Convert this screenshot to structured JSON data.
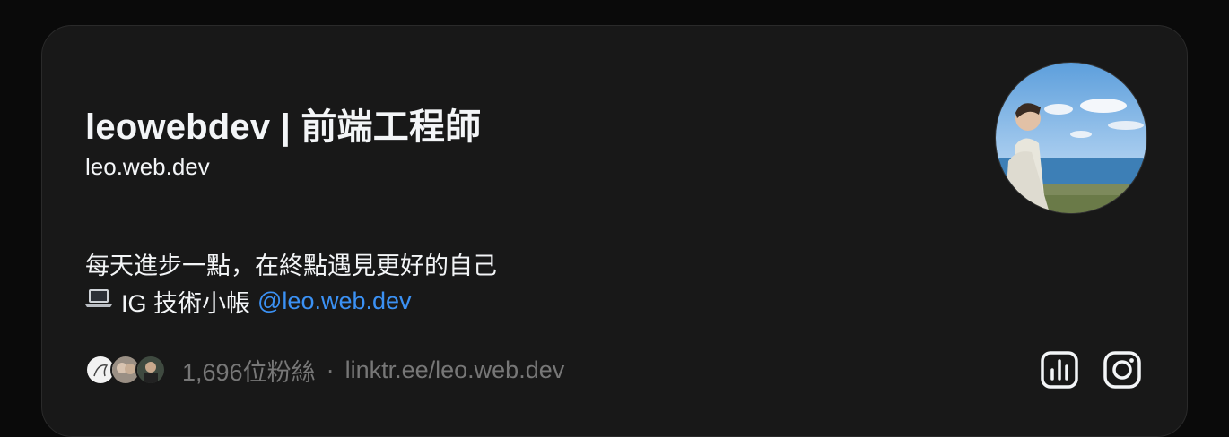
{
  "profile": {
    "display_name": "leowebdev | 前端工程師",
    "username": "leo.web.dev",
    "bio_line1": "每天進步一點，在終點遇見更好的自己",
    "bio_line2_text": "IG 技術小帳",
    "bio_line2_link": "@leo.web.dev",
    "followers": "1,696位粉絲",
    "separator": "·",
    "external_link": "linktr.ee/leo.web.dev"
  },
  "icons": {
    "insights": "bar-chart-icon",
    "instagram": "instagram-icon",
    "laptop": "laptop-emoji-icon"
  },
  "colors": {
    "background": "#0a0a0a",
    "card": "#181818",
    "link": "#3b91f4",
    "muted": "#777777",
    "text": "#f3f5f7"
  }
}
